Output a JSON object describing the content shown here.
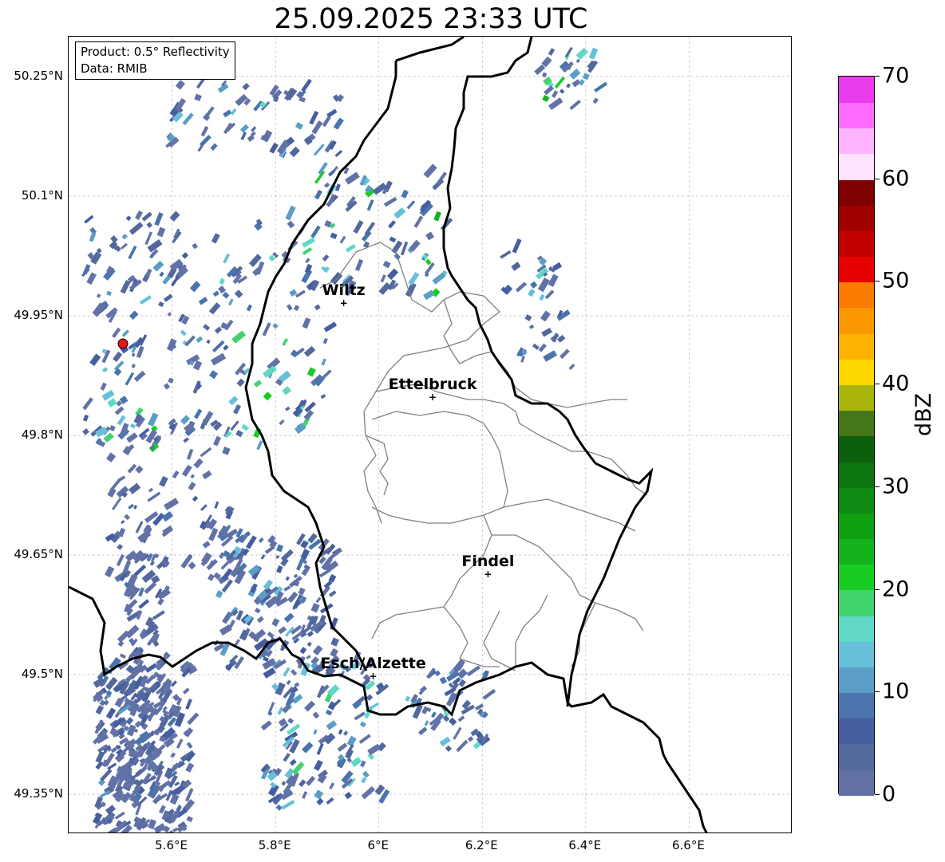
{
  "title": "25.09.2025 23:33 UTC",
  "info_box": {
    "product": "Product: 0.5° Reflectivity",
    "data_source": "Data: RMIB"
  },
  "axes": {
    "lat_ticks": [
      "50.25°N",
      "50.1°N",
      "49.95°N",
      "49.8°N",
      "49.65°N",
      "49.5°N",
      "49.35°N"
    ],
    "lon_ticks": [
      "5.6°E",
      "5.8°E",
      "6°E",
      "6.2°E",
      "6.4°E",
      "6.6°E"
    ],
    "lat_values": [
      50.25,
      50.1,
      49.95,
      49.8,
      49.65,
      49.5,
      49.35
    ],
    "lon_values": [
      5.6,
      5.8,
      6.0,
      6.2,
      6.4,
      6.6
    ],
    "lat_range": [
      49.3,
      50.3
    ],
    "lon_range": [
      5.4,
      6.8
    ]
  },
  "cities": [
    {
      "name": "Wiltz",
      "lat": 49.966,
      "lon": 5.932
    },
    {
      "name": "Ettelbruck",
      "lat": 49.848,
      "lon": 6.104
    },
    {
      "name": "Findel",
      "lat": 49.626,
      "lon": 6.211
    },
    {
      "name": "Esch/Alzette",
      "lat": 49.498,
      "lon": 5.989
    }
  ],
  "radar_site": {
    "lat": 49.915,
    "lon": 5.505,
    "color": "#e8141a"
  },
  "colorbar": {
    "unit": "dBZ",
    "min": 0,
    "max": 70,
    "tick_labels": [
      "0",
      "10",
      "20",
      "30",
      "40",
      "50",
      "60",
      "70"
    ],
    "tick_values": [
      0,
      10,
      20,
      30,
      40,
      50,
      60,
      70
    ],
    "colors": [
      "#6272a6",
      "#53689d",
      "#465e9f",
      "#4a74ab",
      "#5a9dc6",
      "#66c0da",
      "#5fd8c6",
      "#3fd26d",
      "#18cc24",
      "#14b21b",
      "#119f12",
      "#0e8a12",
      "#0b7510",
      "#0c5f0c",
      "#46761a",
      "#a8b40b",
      "#ffd800",
      "#fcb400",
      "#fb9800",
      "#fb7c00",
      "#e60000",
      "#c20000",
      "#a00000",
      "#7e0000",
      "#ffe2ff",
      "#ffb4ff",
      "#ff6cff",
      "#e83ced"
    ]
  }
}
